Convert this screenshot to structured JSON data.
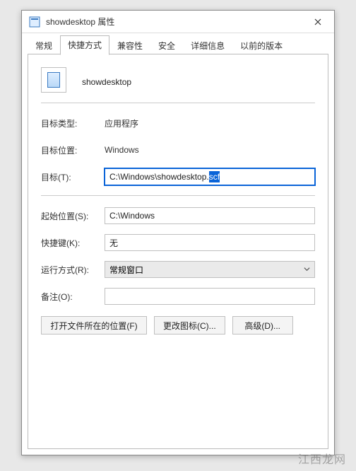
{
  "titlebar": {
    "title": "showdesktop 属性"
  },
  "tabs": {
    "general": "常规",
    "shortcut": "快捷方式",
    "compat": "兼容性",
    "security": "安全",
    "details": "详细信息",
    "previous": "以前的版本"
  },
  "header": {
    "filename": "showdesktop"
  },
  "fields": {
    "target_type_label": "目标类型:",
    "target_type_value": "应用程序",
    "target_loc_label": "目标位置:",
    "target_loc_value": "Windows",
    "target_label": "目标(T):",
    "target_value_prefix": "C:\\Windows\\showdesktop.",
    "target_value_selected": "scf",
    "start_in_label": "起始位置(S):",
    "start_in_value": "C:\\Windows",
    "shortcut_key_label": "快捷键(K):",
    "shortcut_key_value": "无",
    "run_label": "运行方式(R):",
    "run_value": "常规窗口",
    "comment_label": "备注(O):",
    "comment_value": ""
  },
  "buttons": {
    "open_location": "打开文件所在的位置(F)",
    "change_icon": "更改图标(C)...",
    "advanced": "高级(D)..."
  },
  "watermark": "江西龙网"
}
